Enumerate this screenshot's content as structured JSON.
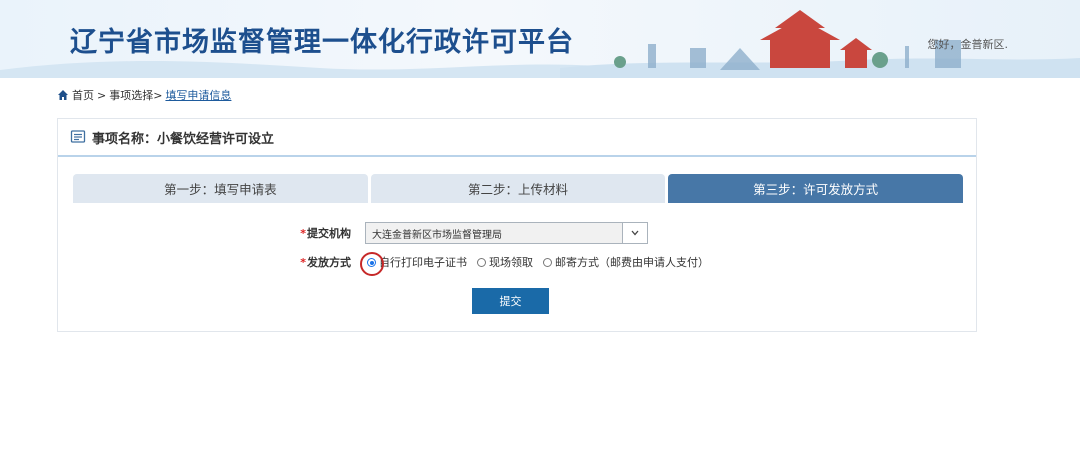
{
  "header": {
    "title": "辽宁省市场监督管理一体化行政许可平台",
    "greeting": "您好，金普新区."
  },
  "breadcrumb": {
    "home": "首页",
    "sep1": ">",
    "item1": "事项选择>",
    "current": "填写申请信息"
  },
  "card": {
    "title": "事项名称：小餐饮经营许可设立"
  },
  "steps": [
    {
      "label": "第一步：填写申请表"
    },
    {
      "label": "第二步：上传材料"
    },
    {
      "label": "第三步：许可发放方式",
      "active": true
    }
  ],
  "form": {
    "org_label": "提交机构",
    "org_value": "大连金普新区市场监督管理局",
    "method_label": "发放方式",
    "required_mark": "*",
    "options": [
      {
        "label": "自行打印电子证书",
        "checked": true
      },
      {
        "label": "现场领取",
        "checked": false
      },
      {
        "label": "邮寄方式（邮费由申请人支付）",
        "checked": false
      }
    ],
    "submit": "提交"
  },
  "colors": {
    "title": "#1d4f8e",
    "active_step": "#4777a7",
    "submit": "#1a6aa8",
    "highlight_circle": "#c62828"
  }
}
